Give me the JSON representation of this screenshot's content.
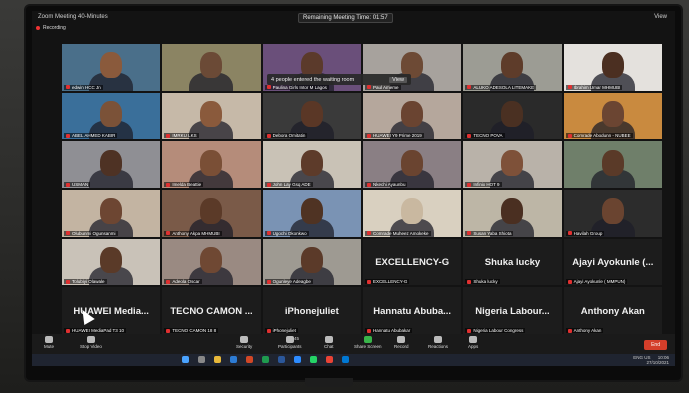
{
  "window": {
    "title": "Zoom Meeting 40-Minutes",
    "view_label": "View",
    "remaining": "Remaining Meeting Time: 01:57",
    "recording": "Recording"
  },
  "notification": {
    "text": "4 people entered the waiting room",
    "view_btn": "View"
  },
  "tiles": [
    {
      "name": "edwin HCC Jn",
      "type": "video",
      "skin": "#8a5a3c",
      "bg": "#4a6f8a"
    },
    {
      "name": "",
      "type": "video",
      "skin": "#6b4a36",
      "bg": "#8b8463"
    },
    {
      "name": "Paulina Girls Intor M Lagos",
      "type": "video",
      "skin": "#5b3a2b",
      "bg": "#6a4f7a"
    },
    {
      "name": "Paul Ameme",
      "type": "video",
      "skin": "#6d4a35",
      "bg": "#a7a29d"
    },
    {
      "name": "ALUKO ADESOLA LITEMAKE",
      "type": "video",
      "skin": "#5e3c2a",
      "bg": "#9c9c94"
    },
    {
      "name": "Ibrahim Umar MHMUBI",
      "type": "video",
      "skin": "#4b2f21",
      "bg": "#e4e1dd"
    },
    {
      "name": "ABEL AHMED KABIR",
      "type": "video",
      "skin": "#7b5238",
      "bg": "#3a6f9a"
    },
    {
      "name": "IMRKU LKS",
      "type": "video",
      "skin": "#8a5a3c",
      "bg": "#c6b9a8"
    },
    {
      "name": "Debora Omitatin",
      "type": "video",
      "skin": "#5a3726",
      "bg": "#3a3a3a"
    },
    {
      "name": "HUAWEI Y9 Prime 2019",
      "type": "video",
      "skin": "#6a4431",
      "bg": "#b5a79c"
    },
    {
      "name": "TECNO POVA",
      "type": "video",
      "skin": "#4a3022",
      "bg": "#2a2a2a"
    },
    {
      "name": "Comrade Abodunn - NUBEE",
      "type": "video",
      "skin": "#6b4532",
      "bg": "#c98a3f"
    },
    {
      "name": "USMAN",
      "type": "video",
      "skin": "#4e3224",
      "bg": "#8f8f94"
    },
    {
      "name": "Imelda Beattie",
      "type": "video",
      "skin": "#7a4f36",
      "bg": "#b58c7a"
    },
    {
      "name": "John Lay Gsq ADE",
      "type": "video",
      "skin": "#5d3b2a",
      "bg": "#c9c2b6"
    },
    {
      "name": "Nkechi Ayaunbu",
      "type": "video",
      "skin": "#6a4430",
      "bg": "#8a7f84"
    },
    {
      "name": "Infinix HOT 9",
      "type": "video",
      "skin": "#7e5139",
      "bg": "#b9b2a9"
    },
    {
      "name": "",
      "type": "video",
      "skin": "#5a3a28",
      "bg": "#6f7f6a"
    },
    {
      "name": "Olubunmi Ogunsanmi",
      "type": "video",
      "skin": "#6d4632",
      "bg": "#c3b4a2"
    },
    {
      "name": "Anthony Akpa MHMUBI",
      "type": "video",
      "skin": "#5b3a28",
      "bg": "#7a5a48"
    },
    {
      "name": "Ugochi Okonkwo",
      "type": "video",
      "skin": "#4f3323",
      "bg": "#7a93b4"
    },
    {
      "name": "Comrade Muheez Amokeke",
      "type": "video",
      "skin": "#c9b8a0",
      "bg": "#d9d0c0"
    },
    {
      "name": "Susan Yaba Shiota",
      "type": "video",
      "skin": "#4a2f21",
      "bg": "#bdb6a6"
    },
    {
      "name": "Havilah Group",
      "type": "video",
      "skin": "#6a4430",
      "bg": "#2c2c2c"
    },
    {
      "name": "Tolubiyi Olawale",
      "type": "video",
      "skin": "#5a3a28",
      "bg": "#c9c2b8"
    },
    {
      "name": "Adeola Oscar",
      "type": "video",
      "skin": "#6f4833",
      "bg": "#9a8a82"
    },
    {
      "name": "Ogunleye Adeagbe",
      "type": "video",
      "skin": "#5b3a29",
      "bg": "#9e9a92"
    },
    {
      "name": "EXCELLENCY-G",
      "type": "name",
      "big": "EXCELLENCY-G"
    },
    {
      "name": "Shuka lucky",
      "type": "name",
      "big": "Shuka lucky"
    },
    {
      "name": "Ajayi Ayokunle ( MMPUN)",
      "type": "name",
      "big": "Ajayi Ayokunle (..."
    },
    {
      "name": "HUAWEI MediaPad T3 10",
      "type": "name",
      "big": "HUAWEI Media..."
    },
    {
      "name": "TECNO CAMON 18 8",
      "type": "name",
      "big": "TECNO CAMON ..."
    },
    {
      "name": "iPhonejuliet",
      "type": "name",
      "big": "iPhonejuliet"
    },
    {
      "name": "Hannatu Abubakar",
      "type": "name",
      "big": "Hannatu Abuba..."
    },
    {
      "name": "Nigeria Labour Congress",
      "type": "name",
      "big": "Nigeria Labour..."
    },
    {
      "name": "Anthony Akan",
      "type": "name",
      "big": "Anthony Akan"
    }
  ],
  "toolbar": {
    "mute": "Mute",
    "stop_video": "Stop Video",
    "security": "Security",
    "participants": "Participants",
    "participants_count": "45",
    "chat": "Chat",
    "share": "Share Screen",
    "record": "Record",
    "reactions": "Reactions",
    "apps": "Apps",
    "end": "End"
  },
  "taskbar": {
    "time": "10:06",
    "date": "27/10/2021",
    "lang": "ENG US"
  },
  "colors": {
    "end": "#d43e2a",
    "mic_off": "#e03030"
  }
}
